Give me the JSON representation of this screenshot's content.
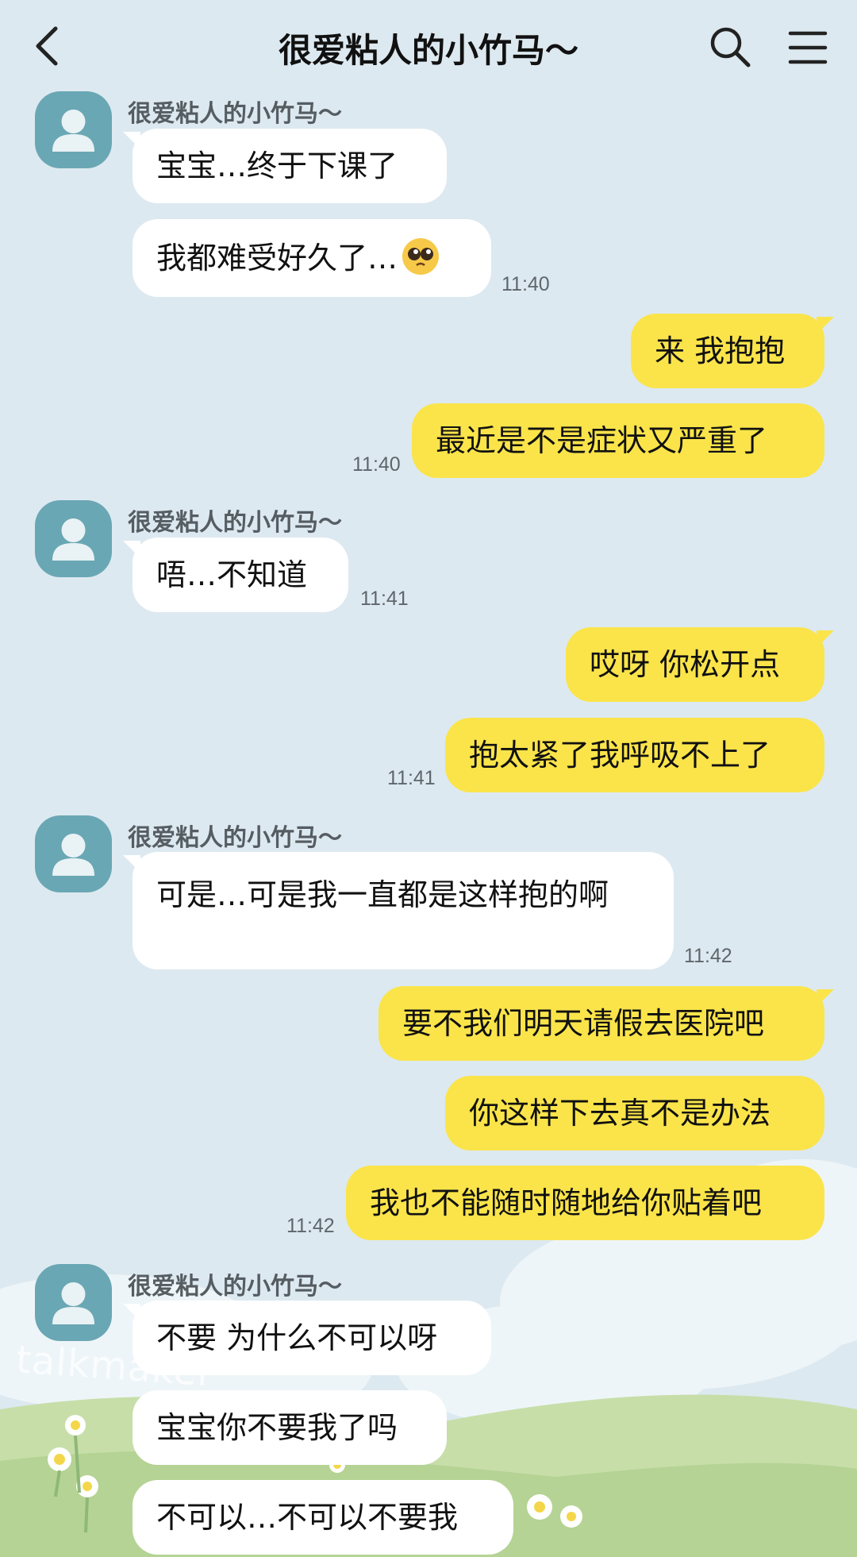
{
  "header": {
    "title": "很爱粘人的小竹马～",
    "back_icon": "chevron-left-icon",
    "search_icon": "search-icon",
    "menu_icon": "hamburger-menu-icon"
  },
  "contact": {
    "name": "很爱粘人的小竹马～",
    "avatar_icon": "default-person-avatar-icon"
  },
  "messages": [
    {
      "from": "contact",
      "text": "宝宝…终于下课了"
    },
    {
      "from": "contact",
      "text": "我都难受好久了…",
      "emoji": "pleading-face-emoji",
      "time": "11:40"
    },
    {
      "from": "me",
      "text": "来 我抱抱"
    },
    {
      "from": "me",
      "text": "最近是不是症状又严重了",
      "time": "11:40"
    },
    {
      "from": "contact",
      "text": "唔…不知道",
      "time": "11:41"
    },
    {
      "from": "me",
      "text": "哎呀 你松开点"
    },
    {
      "from": "me",
      "text": "抱太紧了我呼吸不上了",
      "time": "11:41"
    },
    {
      "from": "contact",
      "text": "可是…可是我一直都是这样抱的啊",
      "time": "11:42"
    },
    {
      "from": "me",
      "text": "要不我们明天请假去医院吧"
    },
    {
      "from": "me",
      "text": "你这样下去真不是办法"
    },
    {
      "from": "me",
      "text": "我也不能随时随地给你贴着吧",
      "time": "11:42"
    },
    {
      "from": "contact",
      "text": "不要 为什么不可以呀"
    },
    {
      "from": "contact",
      "text": "宝宝你不要我了吗"
    },
    {
      "from": "contact",
      "text": "不可以…不可以不要我"
    }
  ],
  "watermark": "talkmaker",
  "colors": {
    "background": "#dde9f0",
    "incoming_bubble": "#ffffff",
    "outgoing_bubble": "#fae44a",
    "avatar": "#6aa7b4",
    "grass": "#b9d69a"
  }
}
